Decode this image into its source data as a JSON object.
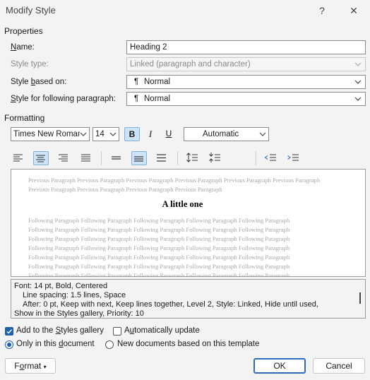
{
  "dialog": {
    "title": "Modify Style",
    "help_glyph": "?",
    "close_glyph": "✕"
  },
  "properties": {
    "section_label": "Properties",
    "name_label": "Name:",
    "name_value": "Heading 2",
    "style_type_label": "Style type:",
    "style_type_value": "Linked (paragraph and character)",
    "based_on_label": "Style based on:",
    "based_on_value": "Normal",
    "following_label": "Style for following paragraph:",
    "following_value": "Normal",
    "para_glyph": "¶"
  },
  "formatting": {
    "section_label": "Formatting",
    "font_name": "Times New Roman",
    "font_size": "14",
    "bold": "B",
    "italic": "I",
    "underline": "U",
    "color_value": "Automatic"
  },
  "preview": {
    "previous_text": "Previous Paragraph Previous Paragraph Previous Paragraph Previous Paragraph Previous Paragraph Previous Paragraph Previous Paragraph Previous Paragraph Previous Paragraph Previous Paragraph",
    "heading_text": "A little one",
    "following_lines": [
      "Following Paragraph Following Paragraph Following Paragraph Following Paragraph Following Paragraph",
      "Following Paragraph Following Paragraph Following Paragraph Following Paragraph Following Paragraph",
      "Following Paragraph Following Paragraph Following Paragraph Following Paragraph Following Paragraph",
      "Following Paragraph Following Paragraph Following Paragraph Following Paragraph Following Paragraph",
      "Following Paragraph Following Paragraph Following Paragraph Following Paragraph Following Paragraph",
      "Following Paragraph Following Paragraph Following Paragraph Following Paragraph Following Paragraph",
      "Following Paragraph Following Paragraph Following Paragraph Following Paragraph Following Paragraph"
    ]
  },
  "description": {
    "line1": "Font: 14 pt, Bold, Centered",
    "line2": "Line spacing:  1.5 lines, Space",
    "line3": "After:  0 pt, Keep with next, Keep lines together, Level 2, Style: Linked, Hide until used,",
    "line4": "Show in the Styles gallery, Priority: 10"
  },
  "options": {
    "add_to_gallery": "Add to the Styles gallery",
    "auto_update": "Automatically update",
    "only_this_doc": "Only in this document",
    "new_docs": "New documents based on this template"
  },
  "buttons": {
    "format": "Format",
    "ok": "OK",
    "cancel": "Cancel"
  },
  "colors": {
    "accent": "#1f5fb0",
    "active_toggle": "#cfe3f6"
  }
}
